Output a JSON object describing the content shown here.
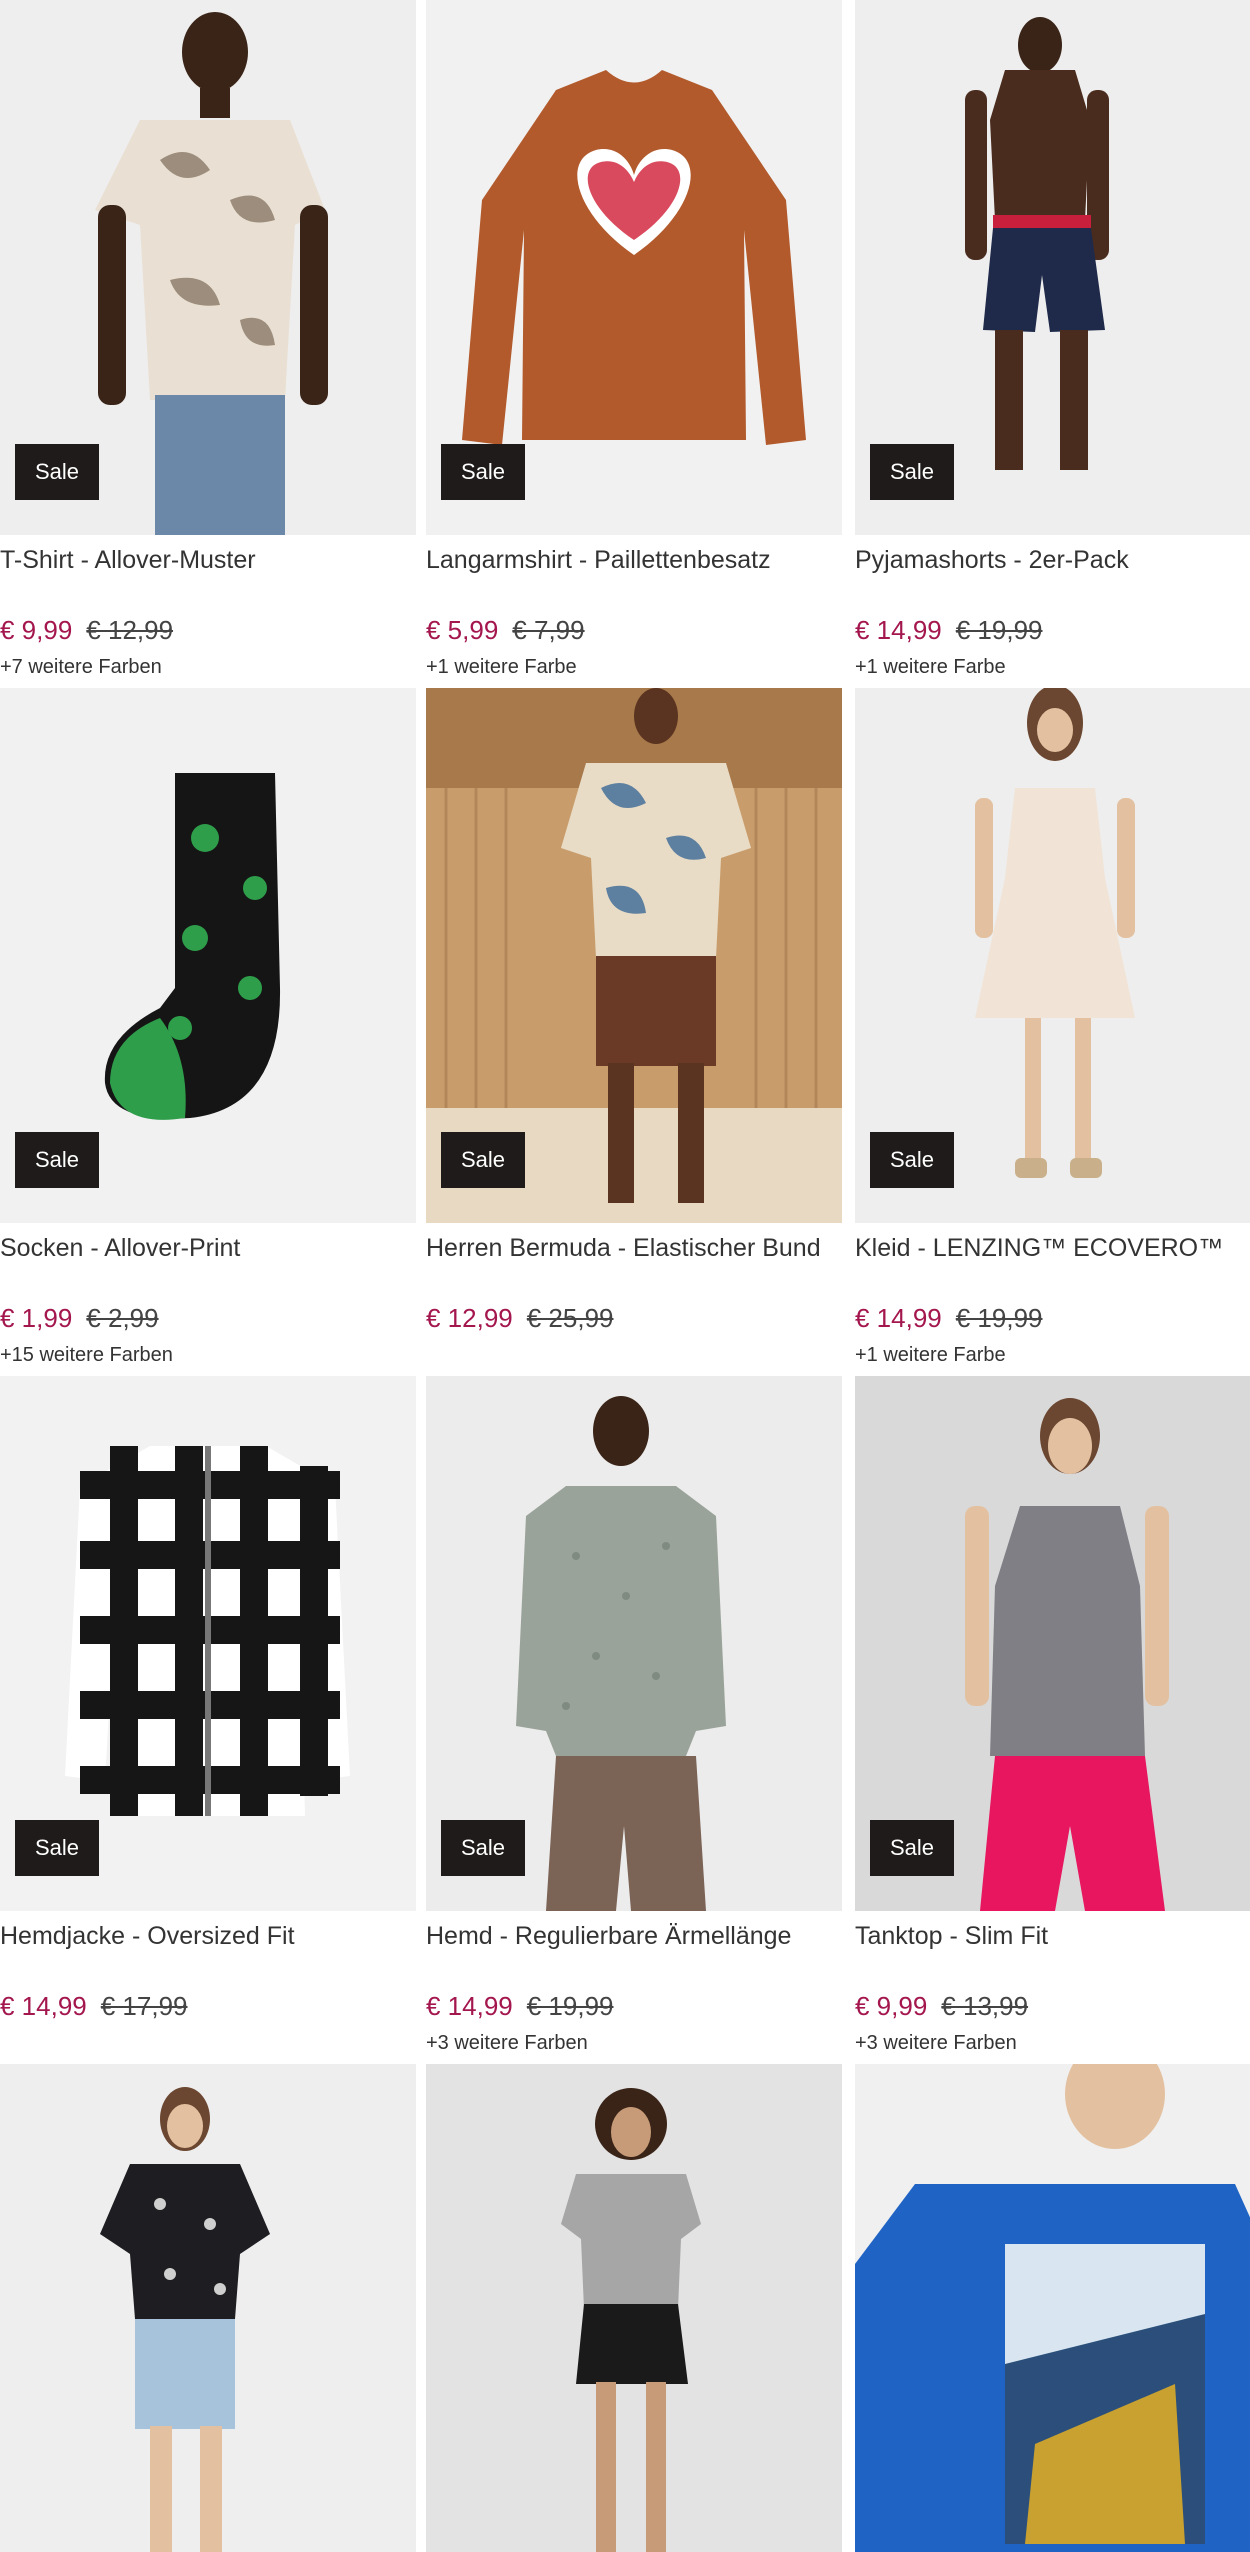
{
  "sale_label": "Sale",
  "products": [
    {
      "title": "T-Shirt - Allover-Muster",
      "price": "€ 9,99",
      "old_price": "€ 12,99",
      "colors": "+7 weitere Farben"
    },
    {
      "title": "Langarmshirt - Paillettenbesatz",
      "price": "€ 5,99",
      "old_price": "€ 7,99",
      "colors": "+1 weitere Farbe"
    },
    {
      "title": "Pyjamashorts - 2er-Pack",
      "price": "€ 14,99",
      "old_price": "€ 19,99",
      "colors": "+1 weitere Farbe"
    },
    {
      "title": "Socken - Allover-Print",
      "price": "€ 1,99",
      "old_price": "€ 2,99",
      "colors": "+15 weitere Farben"
    },
    {
      "title": "Herren Bermuda - Elastischer Bund",
      "price": "€ 12,99",
      "old_price": "€ 25,99",
      "colors": ""
    },
    {
      "title": "Kleid - LENZING™ ECOVERO™",
      "price": "€ 14,99",
      "old_price": "€ 19,99",
      "colors": "+1 weitere Farbe"
    },
    {
      "title": "Hemdjacke - Oversized Fit",
      "price": "€ 14,99",
      "old_price": "€ 17,99",
      "colors": ""
    },
    {
      "title": "Hemd - Regulierbare Ärmellänge",
      "price": "€ 14,99",
      "old_price": "€ 19,99",
      "colors": "+3 weitere Farben"
    },
    {
      "title": "Tanktop - Slim Fit",
      "price": "€ 9,99",
      "old_price": "€ 13,99",
      "colors": "+3 weitere Farben"
    },
    {
      "title": "",
      "price": "",
      "old_price": "",
      "colors": ""
    },
    {
      "title": "",
      "price": "",
      "old_price": "",
      "colors": ""
    },
    {
      "title": "",
      "price": "",
      "old_price": "",
      "colors": ""
    }
  ],
  "colors": {
    "accent": "#a4174e",
    "badge": "#1f1b1a",
    "image_bg": "#efefef"
  }
}
